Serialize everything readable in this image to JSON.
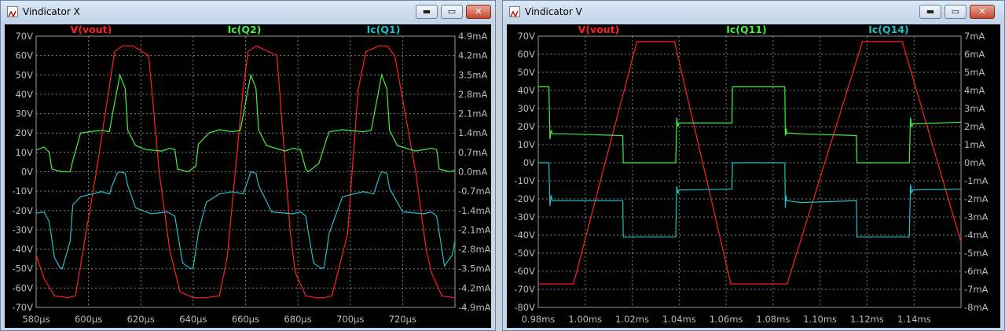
{
  "windows": [
    {
      "title": "Vindicator X",
      "controls": {
        "minimize": "▬",
        "restore": "▭",
        "close": "✕"
      }
    },
    {
      "title": "Vindicator V",
      "controls": {
        "minimize": "▬",
        "restore": "▭",
        "close": "✕"
      }
    }
  ],
  "chart_data": [
    {
      "type": "line",
      "grid": true,
      "xlim": [
        580,
        740
      ],
      "ylim": [
        -70,
        70
      ],
      "y2lim": [
        -4.9,
        4.9
      ],
      "x_ticks": [
        "580µs",
        "600µs",
        "620µs",
        "640µs",
        "660µs",
        "680µs",
        "700µs",
        "720µs"
      ],
      "x_tick_values": [
        580,
        600,
        620,
        640,
        660,
        680,
        700,
        720
      ],
      "y_ticks": [
        "70V",
        "60V",
        "50V",
        "40V",
        "30V",
        "20V",
        "10V",
        "0V",
        "-10V",
        "-20V",
        "-30V",
        "-40V",
        "-50V",
        "-60V",
        "-70V"
      ],
      "y_tick_values": [
        70,
        60,
        50,
        40,
        30,
        20,
        10,
        0,
        -10,
        -20,
        -30,
        -40,
        -50,
        -60,
        -70
      ],
      "y2_ticks": [
        "4.9mA",
        "4.2mA",
        "3.5mA",
        "2.8mA",
        "2.1mA",
        "1.4mA",
        "0.7mA",
        "0.0mA",
        "-0.7mA",
        "-1.4mA",
        "-2.1mA",
        "-2.8mA",
        "-3.5mA",
        "-4.2mA",
        "-4.9mA"
      ],
      "series": [
        {
          "name": "V(vout)",
          "color": "#ff2020",
          "axis": "left",
          "x": [
            580,
            583,
            587,
            592,
            595,
            603,
            610,
            613,
            617,
            623,
            627,
            631,
            635,
            640,
            645,
            650,
            653,
            659,
            661,
            664,
            672,
            677,
            679,
            683,
            687,
            690,
            693,
            699,
            703,
            706,
            711,
            714,
            717,
            725,
            729,
            731,
            735,
            740
          ],
          "y": [
            -43,
            -55,
            -64,
            -65,
            -64,
            0,
            62,
            65,
            65,
            60,
            0,
            -40,
            -62,
            -65,
            -65,
            -64,
            -44,
            42,
            62,
            65,
            60,
            -30,
            -52,
            -64,
            -65,
            -65,
            -64,
            -32,
            42,
            62,
            65,
            65,
            60,
            0,
            -40,
            -52,
            -64,
            -65
          ]
        },
        {
          "name": "Ic(Q2)",
          "color": "#40f040",
          "axis": "right",
          "x": [
            580,
            583,
            585,
            586,
            590,
            593,
            594,
            597,
            605,
            608,
            609,
            611,
            612,
            614,
            615,
            618,
            622,
            628,
            631,
            633,
            634,
            638,
            641,
            642,
            646,
            650,
            655,
            658,
            659,
            661,
            662,
            664,
            665,
            668,
            675,
            678,
            681,
            683,
            684,
            688,
            691,
            692,
            697,
            705,
            708,
            709,
            711,
            712,
            714,
            715,
            718,
            725,
            731,
            733,
            734,
            738,
            740
          ],
          "y": [
            0.78,
            0.9,
            0.7,
            0.1,
            0,
            0,
            0.4,
            1.4,
            1.5,
            1.45,
            2.0,
            3.0,
            3.5,
            3.0,
            1.5,
            0.95,
            0.8,
            0.75,
            0.85,
            0.8,
            0.1,
            0,
            0.2,
            1.0,
            1.4,
            1.52,
            1.45,
            1.5,
            2.0,
            3.0,
            3.5,
            3.0,
            1.5,
            0.95,
            0.75,
            0.85,
            0.8,
            0.1,
            0,
            0.3,
            1.2,
            1.45,
            1.52,
            1.45,
            1.5,
            2.0,
            3.0,
            3.5,
            3.0,
            1.5,
            0.95,
            0.75,
            0.85,
            0.8,
            0.1,
            0,
            0.05
          ]
        },
        {
          "name": "Ic(Q1)",
          "color": "#20c0c8",
          "axis": "right",
          "x": [
            580,
            583,
            585,
            587,
            589,
            590,
            593,
            594,
            597,
            605,
            608,
            609,
            611,
            612,
            614,
            615,
            618,
            624,
            630,
            633,
            634,
            636,
            639,
            640,
            642,
            645,
            650,
            655,
            659,
            661,
            662,
            664,
            665,
            670,
            678,
            681,
            683,
            684,
            686,
            689,
            690,
            692,
            697,
            705,
            709,
            711,
            712,
            714,
            715,
            720,
            728,
            731,
            733,
            734,
            736,
            739,
            740
          ],
          "y": [
            -1.5,
            -1.45,
            -1.8,
            -3.1,
            -3.45,
            -3.5,
            -2.5,
            -1.2,
            -0.9,
            -0.72,
            -0.8,
            -0.5,
            -0.05,
            0,
            -0.05,
            -0.5,
            -1.3,
            -1.52,
            -1.45,
            -1.6,
            -2.2,
            -3.3,
            -3.5,
            -3.45,
            -2.2,
            -1.1,
            -0.8,
            -0.72,
            -0.8,
            -0.3,
            0,
            -0.05,
            -0.5,
            -1.45,
            -1.52,
            -1.45,
            -1.6,
            -2.2,
            -3.3,
            -3.5,
            -3.45,
            -2.2,
            -0.9,
            -0.72,
            -0.8,
            -0.2,
            0,
            -0.05,
            -0.6,
            -1.45,
            -1.52,
            -1.45,
            -1.6,
            -2.2,
            -3.4,
            -3.0,
            -2.5
          ]
        }
      ]
    },
    {
      "type": "line",
      "grid": true,
      "xlim": [
        0.98,
        1.16
      ],
      "ylim": [
        -80,
        70
      ],
      "y2lim": [
        -8,
        7
      ],
      "x_ticks": [
        "0.98ms",
        "1.00ms",
        "1.02ms",
        "1.04ms",
        "1.06ms",
        "1.08ms",
        "1.10ms",
        "1.12ms",
        "1.14ms"
      ],
      "x_tick_values": [
        0.98,
        1.0,
        1.02,
        1.04,
        1.06,
        1.08,
        1.1,
        1.12,
        1.14
      ],
      "y_ticks": [
        "70V",
        "60V",
        "50V",
        "40V",
        "30V",
        "20V",
        "10V",
        "0V",
        "-10V",
        "-20V",
        "-30V",
        "-40V",
        "-50V",
        "-60V",
        "-70V",
        "-80V"
      ],
      "y_tick_values": [
        70,
        60,
        50,
        40,
        30,
        20,
        10,
        0,
        -10,
        -20,
        -30,
        -40,
        -50,
        -60,
        -70,
        -80
      ],
      "y2_ticks": [
        "7mA",
        "6mA",
        "5mA",
        "4mA",
        "3mA",
        "2mA",
        "1mA",
        "0mA",
        "-1mA",
        "-2mA",
        "-3mA",
        "-4mA",
        "-5mA",
        "-6mA",
        "-7mA",
        "-8mA"
      ],
      "series": [
        {
          "name": "V(vout)",
          "color": "#ff2020",
          "axis": "left",
          "x": [
            0.98,
            0.995,
            1.022,
            1.038,
            1.062,
            1.086,
            1.118,
            1.135,
            1.16
          ],
          "y": [
            -67,
            -67,
            67,
            67,
            -67,
            -67,
            67,
            67,
            -44
          ]
        },
        {
          "name": "Ic(Q11)",
          "color": "#40f040",
          "axis": "right",
          "x": [
            0.98,
            0.9845,
            0.985,
            0.9855,
            0.986,
            0.992,
            1.016,
            1.0162,
            1.0385,
            1.039,
            1.0395,
            1.04,
            1.046,
            1.0625,
            1.0627,
            1.085,
            1.0852,
            1.0855,
            1.0858,
            1.086,
            1.092,
            1.1155,
            1.1157,
            1.138,
            1.1385,
            1.139,
            1.1395,
            1.16
          ],
          "y": [
            4.2,
            4.2,
            1.3,
            1.8,
            1.6,
            1.6,
            1.5,
            0,
            0,
            2.5,
            2.0,
            2.2,
            2.2,
            2.2,
            4.2,
            4.2,
            1.5,
            1.9,
            1.6,
            1.65,
            1.6,
            1.5,
            0,
            0,
            2.5,
            2.0,
            2.15,
            2.25
          ]
        },
        {
          "name": "Ic(Q14)",
          "color": "#20c0c8",
          "axis": "right",
          "x": [
            0.98,
            0.9845,
            0.985,
            0.9855,
            0.986,
            0.992,
            1.016,
            1.0162,
            1.0385,
            1.039,
            1.0395,
            1.04,
            1.046,
            1.0625,
            1.0627,
            1.085,
            1.0852,
            1.0855,
            1.0858,
            1.086,
            1.092,
            1.1155,
            1.1157,
            1.138,
            1.1385,
            1.139,
            1.1395,
            1.16
          ],
          "y": [
            0,
            0,
            -2.4,
            -1.8,
            -2.1,
            -2.1,
            -2.1,
            -4.1,
            -4.1,
            -1.3,
            -1.7,
            -1.5,
            -1.5,
            -1.45,
            0,
            0,
            -2.5,
            -1.8,
            -2.1,
            -2.1,
            -2.2,
            -2.1,
            -4.1,
            -4.1,
            -1.2,
            -1.7,
            -1.5,
            -1.45
          ]
        }
      ]
    }
  ]
}
